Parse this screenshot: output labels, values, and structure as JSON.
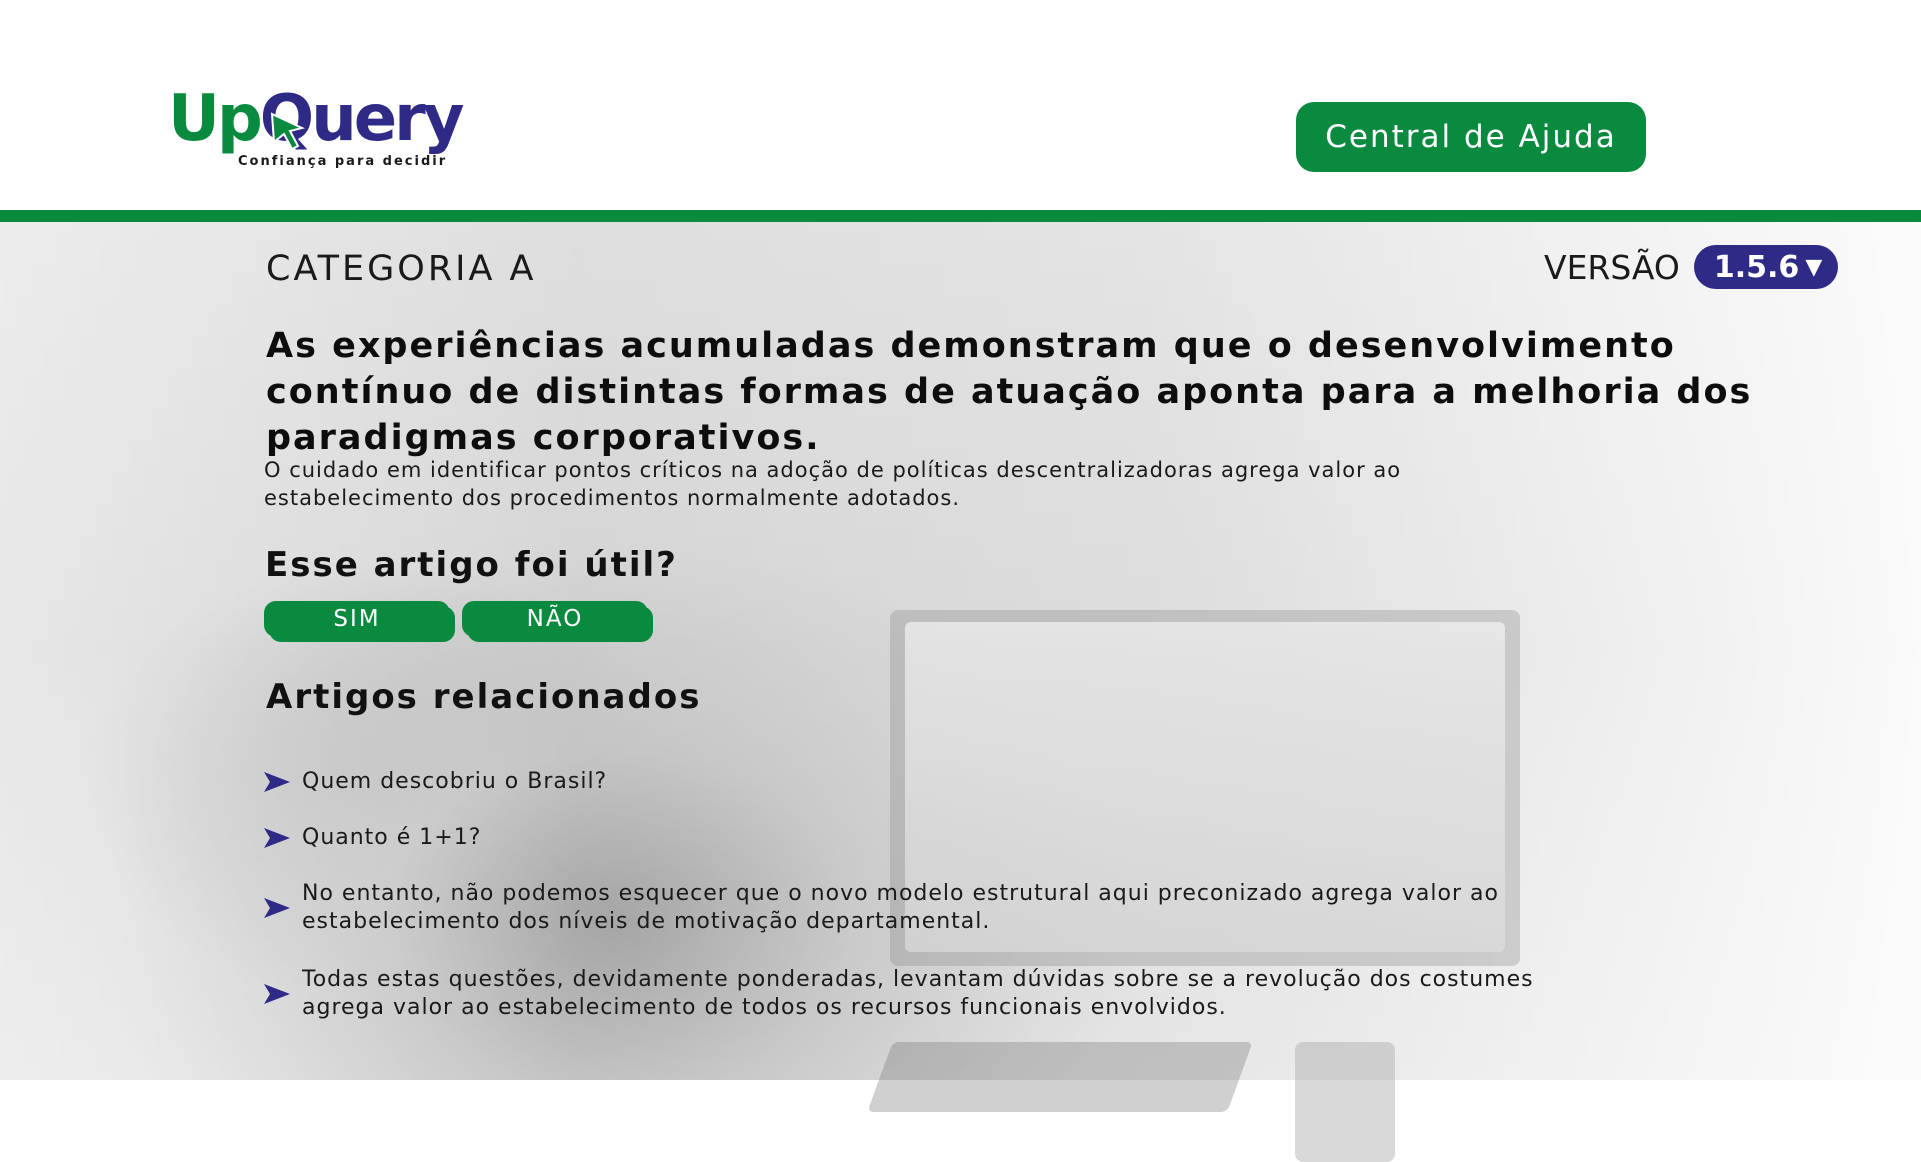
{
  "header": {
    "logo": {
      "word_up": "Up",
      "word_query": "Query",
      "tagline": "Confiança para decidir"
    },
    "help_button_label": "Central de Ajuda"
  },
  "colors": {
    "brand_green": "#0a8a3f",
    "brand_purple": "#2e2a86"
  },
  "article": {
    "category": "CATEGORIA A",
    "version_label": "VERSÃO",
    "version_value": "1.5.6",
    "version_caret": "▼",
    "headline": "As experiências acumuladas demonstram que o desenvolvimento contínuo de distintas formas de atuação aponta para a melhoria dos paradigmas corporativos.",
    "summary": "O cuidado em identificar pontos críticos na adoção de políticas descentralizadoras agrega valor ao estabelecimento dos procedimentos normalmente adotados."
  },
  "feedback": {
    "title": "Esse artigo foi útil?",
    "yes_label": "SIM",
    "no_label": "NÃO"
  },
  "related": {
    "title": "Artigos relacionados",
    "icon": "play-arrow-icon",
    "items": [
      {
        "label": "Quem descobriu o Brasil?"
      },
      {
        "label": "Quanto é 1+1?"
      },
      {
        "label": "No entanto, não podemos esquecer que o novo modelo estrutural aqui preconizado agrega valor ao estabelecimento dos níveis de motivação departamental."
      },
      {
        "label": "Todas estas questões, devidamente ponderadas, levantam dúvidas sobre se a revolução dos costumes agrega valor ao estabelecimento de todos os recursos funcionais envolvidos."
      }
    ]
  }
}
